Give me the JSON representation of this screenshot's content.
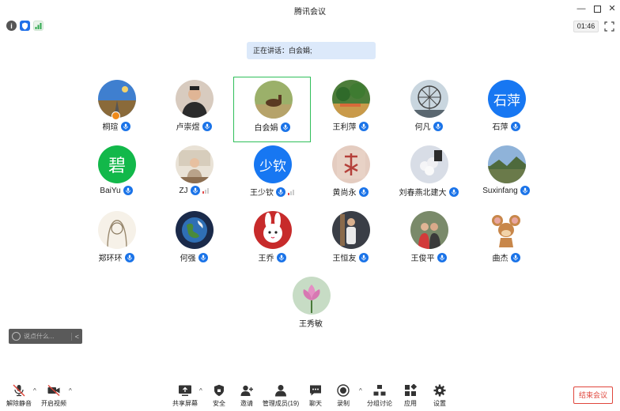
{
  "window": {
    "title": "腾讯会议"
  },
  "status": {
    "timer": "01:46"
  },
  "speaking": {
    "text": "正在讲话：白会娟;"
  },
  "participants": [
    {
      "name": "桐瑄",
      "avatar": "road-sky-photo",
      "mic": true,
      "host": true
    },
    {
      "name": "卢崇煜",
      "avatar": "man-portrait-photo",
      "mic": true
    },
    {
      "name": "白会娟",
      "avatar": "horse-field-photo",
      "mic": true,
      "speaking": true
    },
    {
      "name": "王利萍",
      "avatar": "trees-photo",
      "mic": true
    },
    {
      "name": "何凡",
      "avatar": "ferris-wheel-photo",
      "mic": true
    },
    {
      "name": "石萍",
      "avatar_text": "石萍",
      "mic": true
    },
    {
      "name": "BaiYu",
      "avatar_text": "碧",
      "mic": true
    },
    {
      "name": "ZJ",
      "avatar": "woman-table-photo",
      "mic": true,
      "volume": true
    },
    {
      "name": "王少钦",
      "avatar_text": "少钦",
      "mic": true,
      "volume": true
    },
    {
      "name": "黄尚永",
      "avatar": "calligraphy-photo",
      "mic": true
    },
    {
      "name": "刘春燕北建大",
      "avatar": "flowers-photo",
      "mic": true
    },
    {
      "name": "Suxinfang",
      "avatar": "landscape-photo",
      "mic": true
    },
    {
      "name": "郑环环",
      "avatar": "sketch-girl-photo",
      "mic": true
    },
    {
      "name": "何强",
      "avatar": "earth-photo",
      "mic": true
    },
    {
      "name": "王乔",
      "avatar": "cartoon-rabbit-photo",
      "mic": true
    },
    {
      "name": "王恒友",
      "avatar": "man-standing-photo",
      "mic": true
    },
    {
      "name": "王俊平",
      "avatar": "couple-photo",
      "mic": true
    },
    {
      "name": "曲杰",
      "avatar": "jerry-mouse-photo",
      "mic": true
    },
    {
      "name": "王秀敏",
      "avatar": "lotus-photo",
      "mic": false
    }
  ],
  "chat": {
    "placeholder": "说点什么...",
    "collapse": "<"
  },
  "toolbar": {
    "unmute": "解除静音",
    "start_video": "开启视频",
    "share": "共享屏幕",
    "security": "安全",
    "invite": "邀请",
    "members": "管理成员(19)",
    "chat": "聊天",
    "record": "录制",
    "breakout": "分组讨论",
    "apps": "应用",
    "settings": "设置",
    "end": "结束会议"
  },
  "colors": {
    "accent": "#1a73e8",
    "speaking_border": "#2fbf5a",
    "end": "#e0463c"
  }
}
